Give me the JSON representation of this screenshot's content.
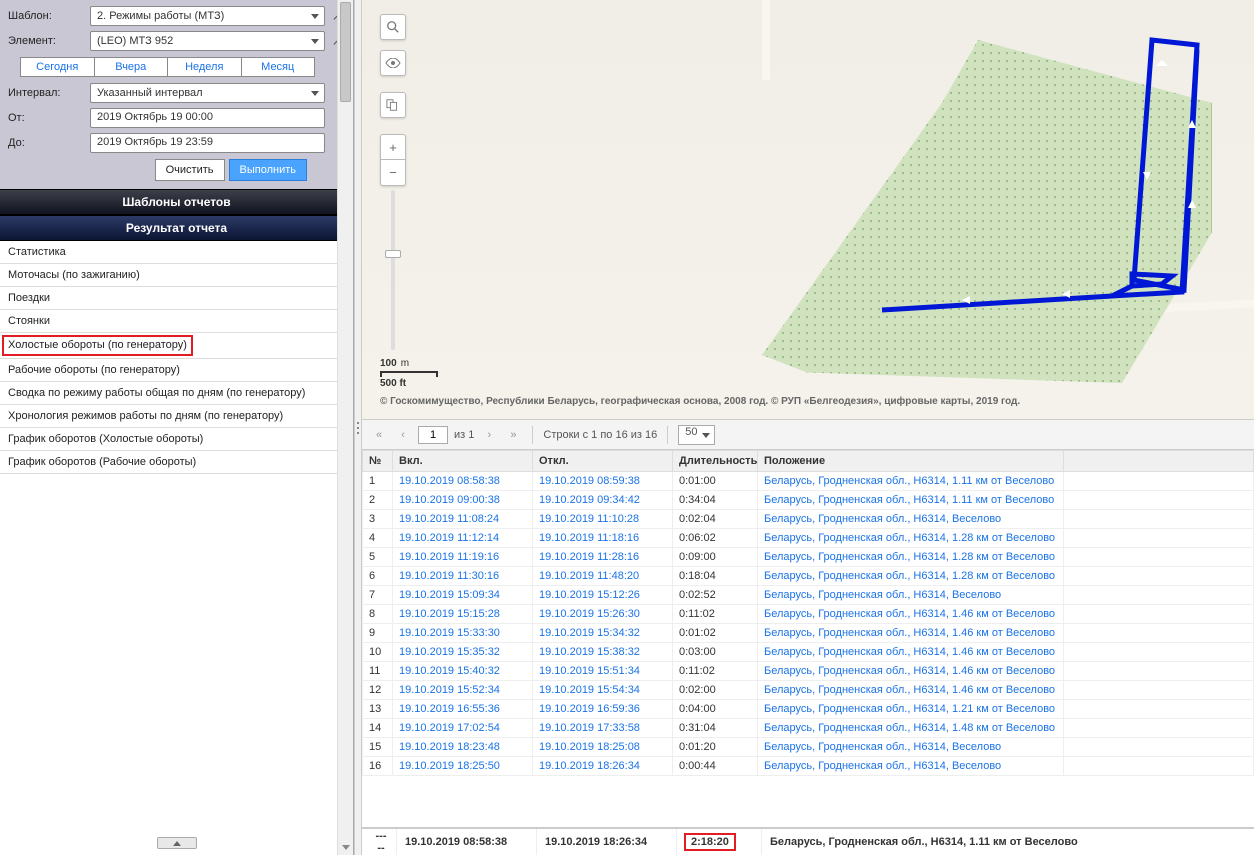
{
  "sidebar": {
    "labels": {
      "template": "Шаблон:",
      "element": "Элемент:",
      "interval": "Интервал:",
      "from": "От:",
      "to": "До:"
    },
    "template_value": "2. Режимы работы (МТЗ)",
    "element_value": "(LEO) МТЗ 952",
    "range_buttons": [
      "Сегодня",
      "Вчера",
      "Неделя",
      "Месяц"
    ],
    "interval_value": "Указанный интервал",
    "from_value": "2019 Октябрь 19 00:00",
    "to_value": "2019 Октябрь 19 23:59",
    "clear": "Очистить",
    "run": "Выполнить",
    "section_templates": "Шаблоны отчетов",
    "section_result": "Результат отчета",
    "reports": [
      "Статистика",
      "Моточасы (по зажиганию)",
      "Поездки",
      "Стоянки",
      "Холостые обороты (по генератору)",
      "Рабочие обороты (по генератору)",
      "Сводка по режиму работы общая по дням (по генератору)",
      "Хронология режимов работы по дням (по генератору)",
      "График оборотов (Холостые обороты)",
      "График оборотов (Рабочие обороты)"
    ],
    "highlighted_report_index": 4
  },
  "map": {
    "scale_top": "100",
    "scale_unit_top": "m",
    "scale_bottom": "500 ft",
    "credit": "© Госкомимущество, Республики Беларусь, географическая основа, 2008 год. © РУП «Белгеодезия», цифровые карты, 2019 год."
  },
  "pager": {
    "page": "1",
    "of_label": "из 1",
    "rows_label": "Строки с 1 по 16 из 16",
    "page_size": "50"
  },
  "table": {
    "headers": {
      "no": "№",
      "on": "Вкл.",
      "off": "Откл.",
      "dur": "Длительность",
      "pos": "Положение"
    },
    "rows": [
      {
        "n": "1",
        "on": "19.10.2019 08:58:38",
        "off": "19.10.2019 08:59:38",
        "dur": "0:01:00",
        "pos": "Беларусь, Гродненская обл., Н6314, 1.11 км от Веселово"
      },
      {
        "n": "2",
        "on": "19.10.2019 09:00:38",
        "off": "19.10.2019 09:34:42",
        "dur": "0:34:04",
        "pos": "Беларусь, Гродненская обл., Н6314, 1.11 км от Веселово"
      },
      {
        "n": "3",
        "on": "19.10.2019 11:08:24",
        "off": "19.10.2019 11:10:28",
        "dur": "0:02:04",
        "pos": "Беларусь, Гродненская обл., Н6314, Веселово"
      },
      {
        "n": "4",
        "on": "19.10.2019 11:12:14",
        "off": "19.10.2019 11:18:16",
        "dur": "0:06:02",
        "pos": "Беларусь, Гродненская обл., Н6314, 1.28 км от Веселово"
      },
      {
        "n": "5",
        "on": "19.10.2019 11:19:16",
        "off": "19.10.2019 11:28:16",
        "dur": "0:09:00",
        "pos": "Беларусь, Гродненская обл., Н6314, 1.28 км от Веселово"
      },
      {
        "n": "6",
        "on": "19.10.2019 11:30:16",
        "off": "19.10.2019 11:48:20",
        "dur": "0:18:04",
        "pos": "Беларусь, Гродненская обл., Н6314, 1.28 км от Веселово"
      },
      {
        "n": "7",
        "on": "19.10.2019 15:09:34",
        "off": "19.10.2019 15:12:26",
        "dur": "0:02:52",
        "pos": "Беларусь, Гродненская обл., Н6314, Веселово"
      },
      {
        "n": "8",
        "on": "19.10.2019 15:15:28",
        "off": "19.10.2019 15:26:30",
        "dur": "0:11:02",
        "pos": "Беларусь, Гродненская обл., Н6314, 1.46 км от Веселово"
      },
      {
        "n": "9",
        "on": "19.10.2019 15:33:30",
        "off": "19.10.2019 15:34:32",
        "dur": "0:01:02",
        "pos": "Беларусь, Гродненская обл., Н6314, 1.46 км от Веселово"
      },
      {
        "n": "10",
        "on": "19.10.2019 15:35:32",
        "off": "19.10.2019 15:38:32",
        "dur": "0:03:00",
        "pos": "Беларусь, Гродненская обл., Н6314, 1.46 км от Веселово"
      },
      {
        "n": "11",
        "on": "19.10.2019 15:40:32",
        "off": "19.10.2019 15:51:34",
        "dur": "0:11:02",
        "pos": "Беларусь, Гродненская обл., Н6314, 1.46 км от Веселово"
      },
      {
        "n": "12",
        "on": "19.10.2019 15:52:34",
        "off": "19.10.2019 15:54:34",
        "dur": "0:02:00",
        "pos": "Беларусь, Гродненская обл., Н6314, 1.46 км от Веселово"
      },
      {
        "n": "13",
        "on": "19.10.2019 16:55:36",
        "off": "19.10.2019 16:59:36",
        "dur": "0:04:00",
        "pos": "Беларусь, Гродненская обл., Н6314, 1.21 км от Веселово"
      },
      {
        "n": "14",
        "on": "19.10.2019 17:02:54",
        "off": "19.10.2019 17:33:58",
        "dur": "0:31:04",
        "pos": "Беларусь, Гродненская обл., Н6314, 1.48 км от Веселово"
      },
      {
        "n": "15",
        "on": "19.10.2019 18:23:48",
        "off": "19.10.2019 18:25:08",
        "dur": "0:01:20",
        "pos": "Беларусь, Гродненская обл., Н6314, Веселово"
      },
      {
        "n": "16",
        "on": "19.10.2019 18:25:50",
        "off": "19.10.2019 18:26:34",
        "dur": "0:00:44",
        "pos": "Беларусь, Гродненская обл., Н6314, Веселово"
      }
    ]
  },
  "totals": {
    "dashes": "-----",
    "on": "19.10.2019 08:58:38",
    "off": "19.10.2019 18:26:34",
    "dur": "2:18:20",
    "pos": "Беларусь, Гродненская обл., Н6314, 1.11 км от Веселово"
  }
}
